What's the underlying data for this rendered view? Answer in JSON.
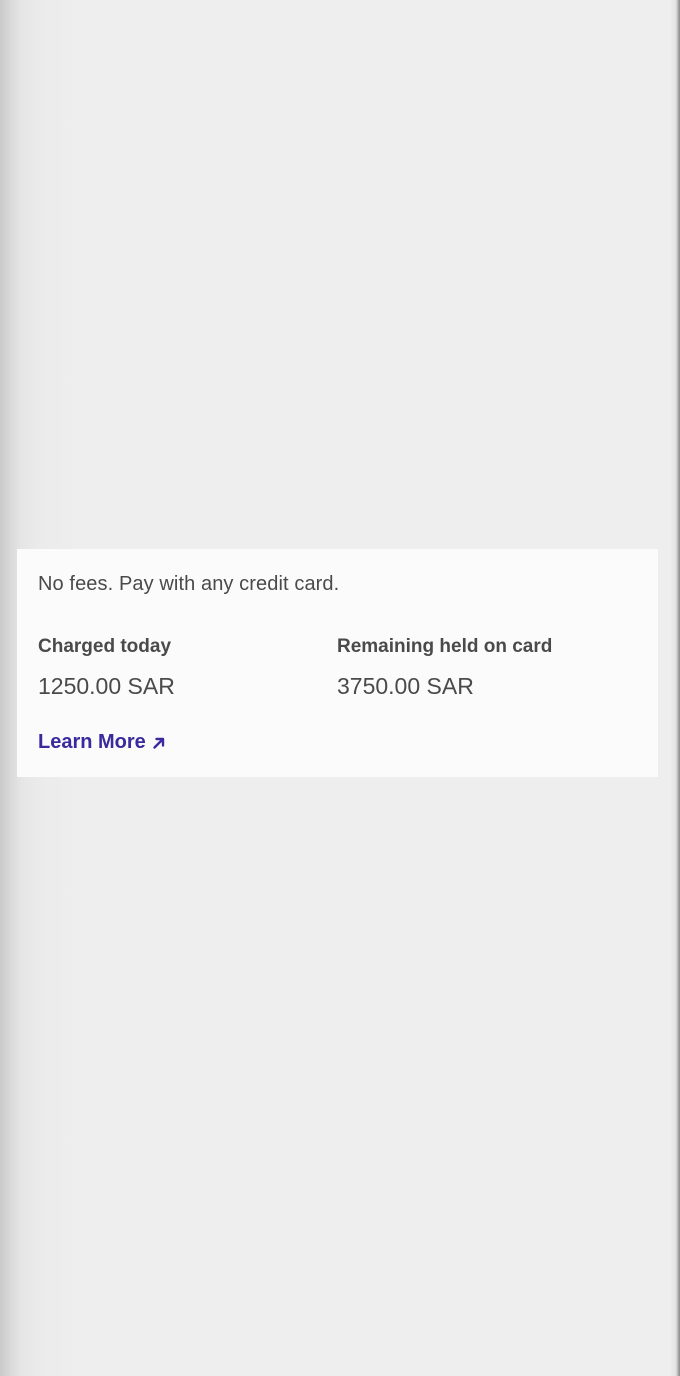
{
  "card": {
    "description": "No fees. Pay with any credit card.",
    "charged_today": {
      "label": "Charged today",
      "value": "1250.00 SAR"
    },
    "remaining_held": {
      "label": "Remaining held on card",
      "value": "3750.00 SAR"
    },
    "learn_more": {
      "label": "Learn More",
      "icon": "arrow-up-right-icon"
    }
  },
  "colors": {
    "background": "#eeeeee",
    "card_background": "#fbfbfb",
    "text": "#4a4a4a",
    "link": "#3a2a9e"
  }
}
